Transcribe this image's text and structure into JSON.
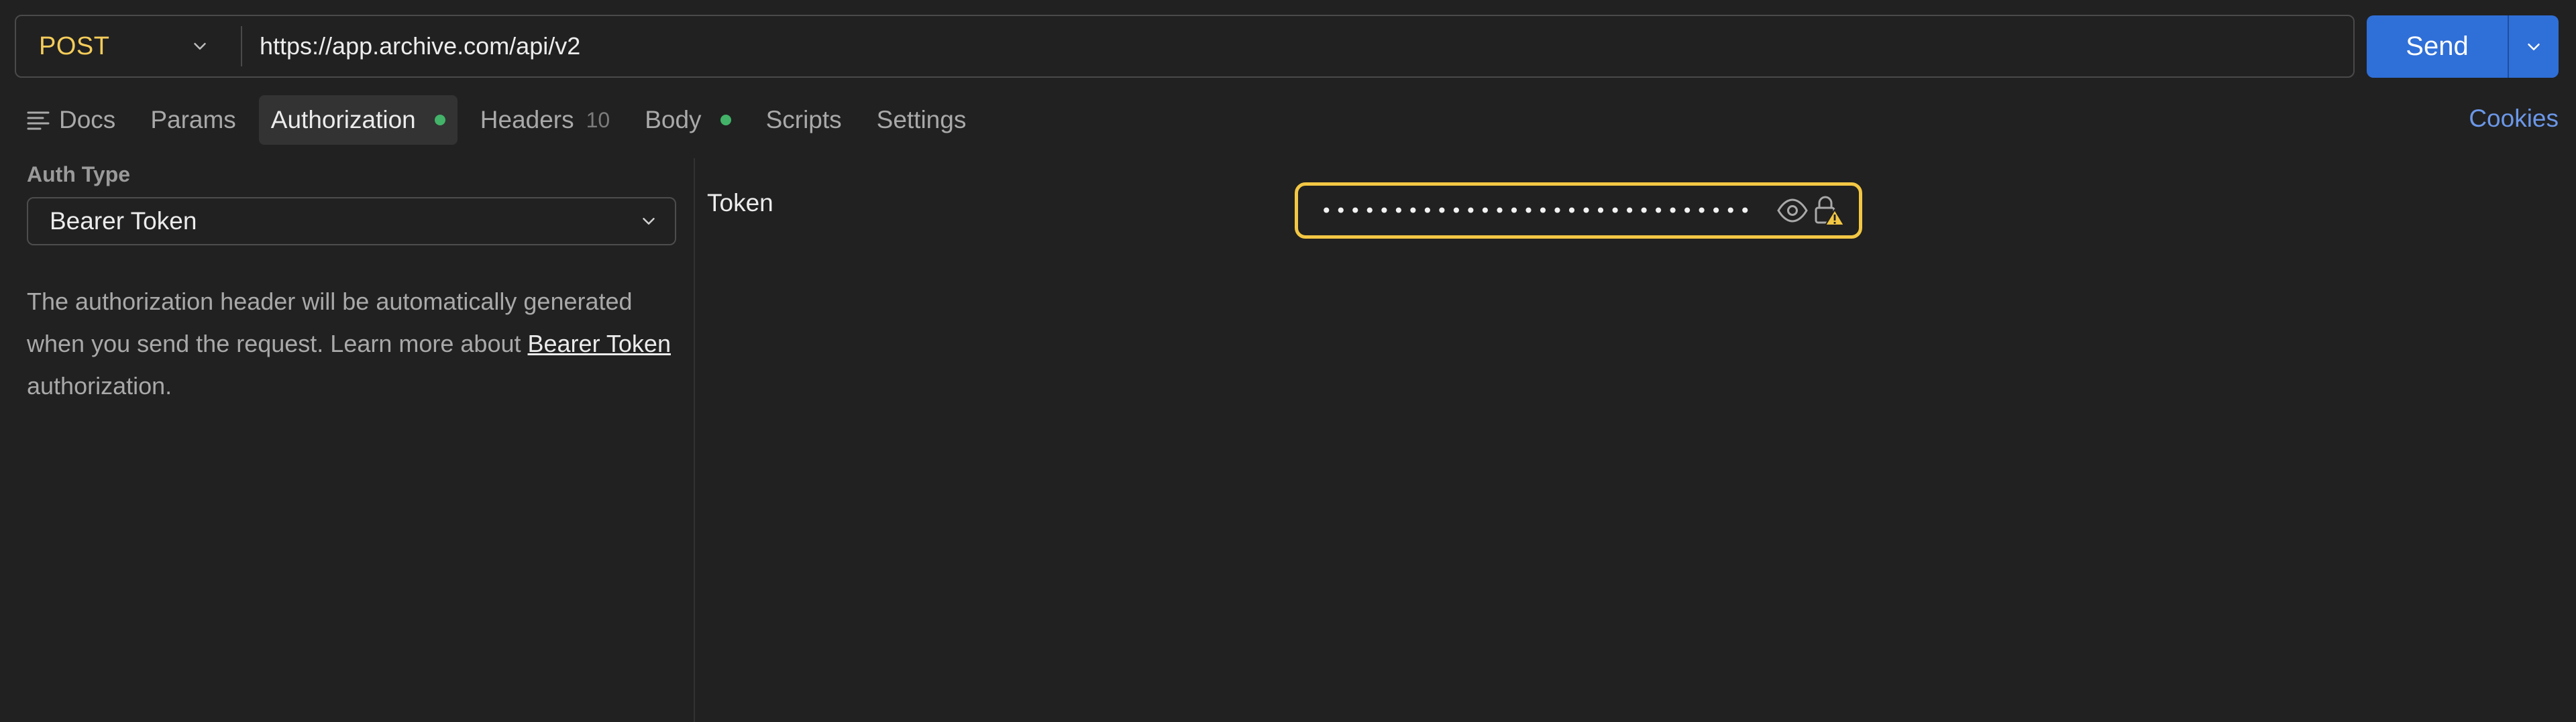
{
  "request": {
    "method": "POST",
    "url": "https://app.archive.com/api/v2",
    "send_label": "Send"
  },
  "tabs": [
    {
      "label": "Docs"
    },
    {
      "label": "Params"
    },
    {
      "label": "Authorization",
      "status_dot": true,
      "active": true
    },
    {
      "label": "Headers",
      "count": "10"
    },
    {
      "label": "Body",
      "status_dot": true
    },
    {
      "label": "Scripts"
    },
    {
      "label": "Settings"
    }
  ],
  "cookies_label": "Cookies",
  "auth": {
    "type_label": "Auth Type",
    "type_value": "Bearer Token",
    "description_before": "The authorization header will be automatically generated when you send the request. Learn more about ",
    "description_link": "Bearer Token",
    "description_after": " authorization."
  },
  "token": {
    "label": "Token",
    "masked_value": "••••••••••••••••••••••••••••••"
  },
  "colors": {
    "background": "#212121",
    "method": "#f5cd5a",
    "send_button": "#2f6fd8",
    "status_dot": "#42b369",
    "link": "#6b97e8",
    "token_border_warning": "#f3c744"
  },
  "icons": [
    "chevron-down-icon",
    "docs-icon",
    "eye-icon",
    "lock-warning-icon"
  ]
}
